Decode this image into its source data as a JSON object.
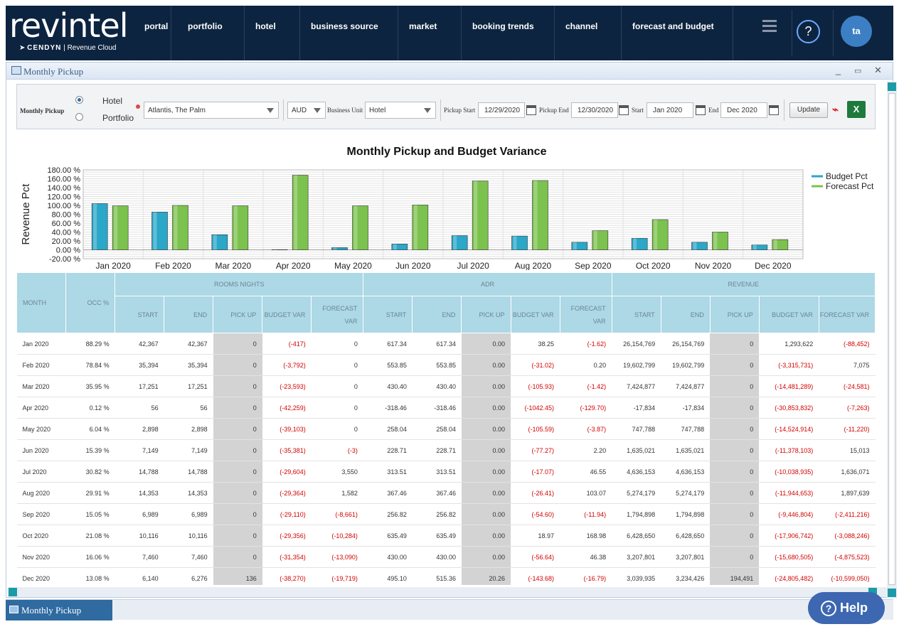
{
  "brand": {
    "logo_regular": "rev",
    "logo_bold": "intel",
    "sub_company": "CENDYN",
    "sub_product": "Revenue Cloud"
  },
  "nav": {
    "items": [
      {
        "label": "portal"
      },
      {
        "label": "portfolio"
      },
      {
        "label": "hotel"
      },
      {
        "label": "business source"
      },
      {
        "label": "market"
      },
      {
        "label": "booking trends"
      },
      {
        "label": "channel"
      },
      {
        "label": "forecast and budget"
      }
    ],
    "help_label": "?",
    "avatar_initials": "ta"
  },
  "window": {
    "title": "Monthly Pickup",
    "minimize": "_",
    "maximize": "▭",
    "close": "✕"
  },
  "toolbar": {
    "report_label": "Monthly Pickup",
    "radio_hotel": "Hotel",
    "radio_portfolio": "Portfolio",
    "selected_scope": "Hotel",
    "property": "Atlantis, The Palm",
    "currency": "AUD",
    "business_unit_label": "Business Unit",
    "business_unit": "Hotel",
    "pickup_start_label": "Pickup Start",
    "pickup_start": "12/29/2020",
    "pickup_end_label": "Pickup End",
    "pickup_end": "12/30/2020",
    "start_label": "Start",
    "start": "Jan 2020",
    "end_label": "End",
    "end": "Dec 2020",
    "update_label": "Update",
    "excel_label": "X"
  },
  "chart_data": {
    "type": "bar",
    "title": "Monthly Pickup and Budget Variance",
    "ylabel": "Revenue Pct",
    "xlabel": "",
    "ylim": [
      -20,
      180
    ],
    "yticks": [
      "180.00 %",
      "160.00 %",
      "140.00 %",
      "120.00 %",
      "100.00 %",
      "80.00 %",
      "60.00 %",
      "40.00 %",
      "20.00 %",
      "0.00 %",
      "-20.00 %"
    ],
    "categories": [
      "Jan 2020",
      "Feb 2020",
      "Mar 2020",
      "Apr 2020",
      "May 2020",
      "Jun 2020",
      "Jul 2020",
      "Aug 2020",
      "Sep 2020",
      "Oct 2020",
      "Nov 2020",
      "Dec 2020"
    ],
    "series": [
      {
        "name": "Budget Pct",
        "color": "#2aa7c9",
        "values": [
          104,
          85,
          34,
          0.5,
          5,
          13,
          32,
          31,
          17,
          26,
          17,
          11
        ]
      },
      {
        "name": "Forecast Pct",
        "color": "#7cc24e",
        "values": [
          99,
          100,
          99,
          168,
          99,
          101,
          155,
          156,
          43,
          68,
          40,
          23
        ]
      }
    ],
    "legend_position": "right",
    "grid": true
  },
  "table": {
    "group_headers": {
      "month": "MONTH",
      "occ": "OCC %",
      "rooms": "ROOMS NIGHTS",
      "adr": "ADR",
      "revenue": "REVENUE"
    },
    "sub_headers": [
      "START",
      "END",
      "PICK UP",
      "BUDGET VAR",
      "FORECAST VAR",
      "START",
      "END",
      "PICK UP",
      "BUDGET VAR",
      "FORECAST VAR",
      "START",
      "END",
      "PICK UP",
      "BUDGET VAR",
      "FORECAST VAR"
    ],
    "rows": [
      [
        "Jan 2020",
        "88.29 %",
        "42,367",
        "42,367",
        "0",
        "(-417)",
        "0",
        "617.34",
        "617.34",
        "0.00",
        "38.25",
        "(-1.62)",
        "26,154,769",
        "26,154,769",
        "0",
        "1,293,622",
        "(-88,452)"
      ],
      [
        "Feb 2020",
        "78.84 %",
        "35,394",
        "35,394",
        "0",
        "(-3,792)",
        "0",
        "553.85",
        "553.85",
        "0.00",
        "(-31.02)",
        "0.20",
        "19,602,799",
        "19,602,799",
        "0",
        "(-3,315,731)",
        "7,075"
      ],
      [
        "Mar 2020",
        "35.95 %",
        "17,251",
        "17,251",
        "0",
        "(-23,593)",
        "0",
        "430.40",
        "430.40",
        "0.00",
        "(-105.93)",
        "(-1.42)",
        "7,424,877",
        "7,424,877",
        "0",
        "(-14,481,289)",
        "(-24,581)"
      ],
      [
        "Apr 2020",
        "0.12 %",
        "56",
        "56",
        "0",
        "(-42,259)",
        "0",
        "-318.46",
        "-318.46",
        "0.00",
        "(-1042.45)",
        "(-129.70)",
        "-17,834",
        "-17,834",
        "0",
        "(-30,853,832)",
        "(-7,263)"
      ],
      [
        "May 2020",
        "6.04 %",
        "2,898",
        "2,898",
        "0",
        "(-39,103)",
        "0",
        "258.04",
        "258.04",
        "0.00",
        "(-105.59)",
        "(-3.87)",
        "747,788",
        "747,788",
        "0",
        "(-14,524,914)",
        "(-11,220)"
      ],
      [
        "Jun 2020",
        "15.39 %",
        "7,149",
        "7,149",
        "0",
        "(-35,381)",
        "(-3)",
        "228.71",
        "228.71",
        "0.00",
        "(-77.27)",
        "2.20",
        "1,635,021",
        "1,635,021",
        "0",
        "(-11,378,103)",
        "15,013"
      ],
      [
        "Jul 2020",
        "30.82 %",
        "14,788",
        "14,788",
        "0",
        "(-29,604)",
        "3,550",
        "313.51",
        "313.51",
        "0.00",
        "(-17.07)",
        "46.55",
        "4,636,153",
        "4,636,153",
        "0",
        "(-10,038,935)",
        "1,636,071"
      ],
      [
        "Aug 2020",
        "29.91 %",
        "14,353",
        "14,353",
        "0",
        "(-29,364)",
        "1,582",
        "367.46",
        "367.46",
        "0.00",
        "(-26.41)",
        "103.07",
        "5,274,179",
        "5,274,179",
        "0",
        "(-11,944,653)",
        "1,897,639"
      ],
      [
        "Sep 2020",
        "15.05 %",
        "6,989",
        "6,989",
        "0",
        "(-29,110)",
        "(-8,661)",
        "256.82",
        "256.82",
        "0.00",
        "(-54.60)",
        "(-11.94)",
        "1,794,898",
        "1,794,898",
        "0",
        "(-9,446,804)",
        "(-2,411,216)"
      ],
      [
        "Oct 2020",
        "21.08 %",
        "10,116",
        "10,116",
        "0",
        "(-29,356)",
        "(-10,284)",
        "635.49",
        "635.49",
        "0.00",
        "18.97",
        "168.98",
        "6,428,650",
        "6,428,650",
        "0",
        "(-17,906,742)",
        "(-3,088,246)"
      ],
      [
        "Nov 2020",
        "16.06 %",
        "7,460",
        "7,460",
        "0",
        "(-31,354)",
        "(-13,090)",
        "430.00",
        "430.00",
        "0.00",
        "(-56.64)",
        "46.38",
        "3,207,801",
        "3,207,801",
        "0",
        "(-15,680,505)",
        "(-4,875,523)"
      ],
      [
        "Dec 2020",
        "13.08 %",
        "6,140",
        "6,276",
        "136",
        "(-38,270)",
        "(-19,719)",
        "495.10",
        "515.36",
        "20.26",
        "(-143.68)",
        "(-16.79)",
        "3,039,935",
        "3,234,426",
        "194,491",
        "(-24,805,482)",
        "(-10,599,050)"
      ]
    ]
  },
  "taskbar": {
    "item_label": "Monthly Pickup"
  },
  "help": {
    "label": "Help",
    "icon": "?"
  }
}
